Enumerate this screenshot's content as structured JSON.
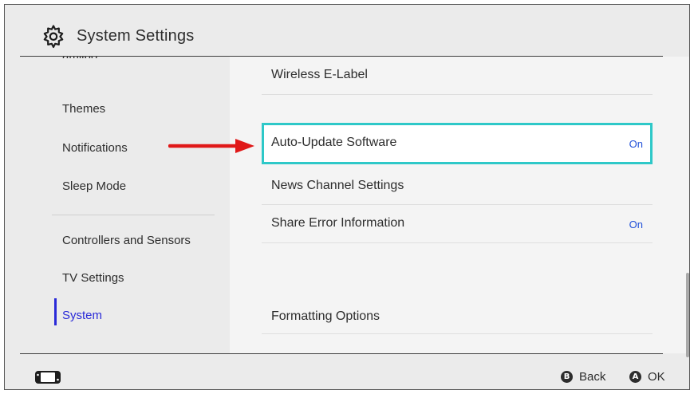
{
  "header": {
    "title": "System Settings",
    "icon": "gear-icon"
  },
  "sidebar": {
    "cut_item": "amiibo",
    "items": [
      {
        "label": "Themes"
      },
      {
        "label": "Notifications"
      },
      {
        "label": "Sleep Mode"
      },
      {
        "label": "Controllers and Sensors"
      },
      {
        "label": "TV Settings"
      },
      {
        "label": "System",
        "active": true
      }
    ]
  },
  "content": {
    "rows": [
      {
        "label": "Wireless E-Label",
        "value": ""
      },
      {
        "label": "Auto-Update Software",
        "value": "On",
        "selected": true
      },
      {
        "label": "News Channel Settings",
        "value": ""
      },
      {
        "label": "Share Error Information",
        "value": "On"
      },
      {
        "label": "Formatting Options",
        "value": ""
      }
    ]
  },
  "footer": {
    "controller_icon": "controller-icon",
    "back": {
      "button": "B",
      "label": "Back"
    },
    "ok": {
      "button": "A",
      "label": "OK"
    }
  },
  "colors": {
    "background": "#ebebeb",
    "content_background": "#f4f4f4",
    "selection_border": "#2ec8c8",
    "active_accent": "#2a2ad8",
    "value_text": "#1f4fd8",
    "annotation_arrow": "#e01818"
  }
}
